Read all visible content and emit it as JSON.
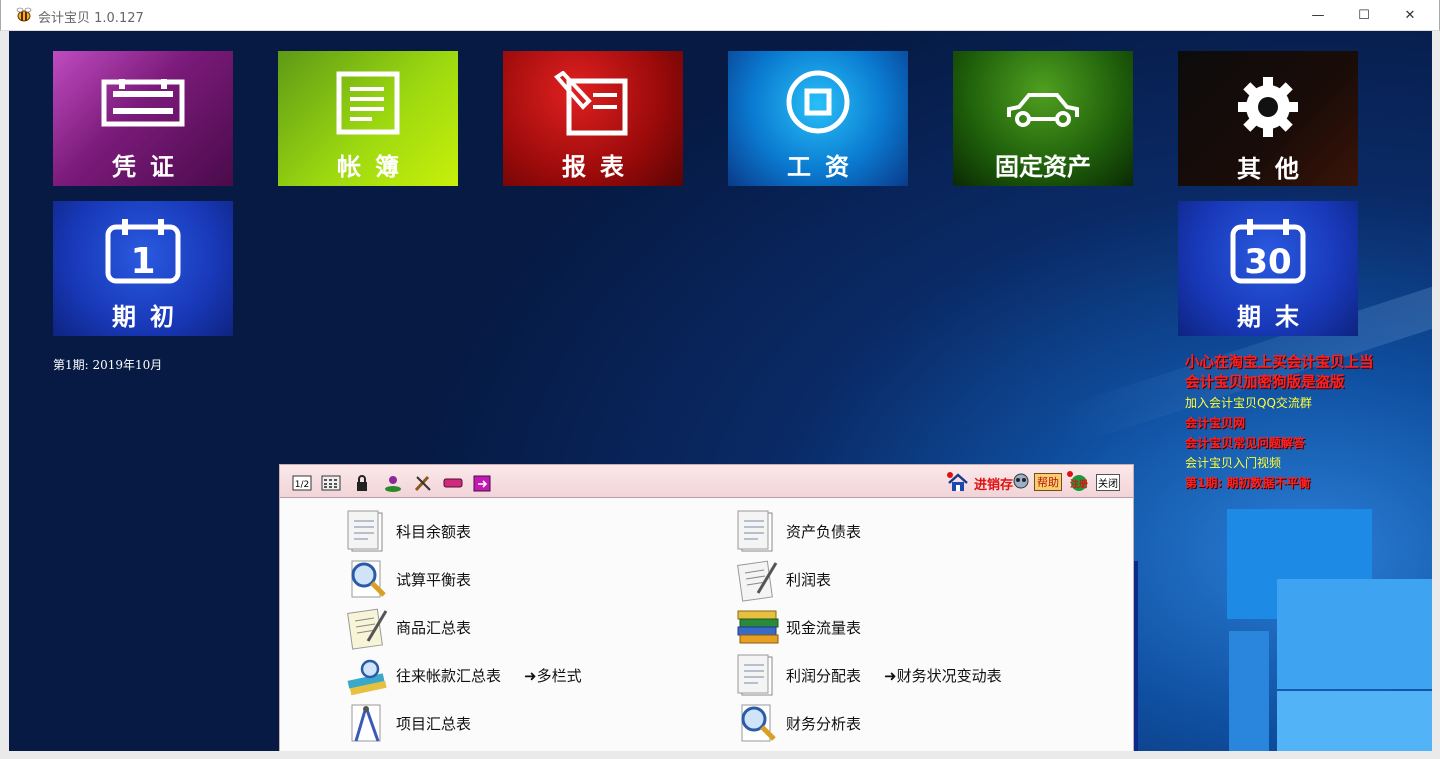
{
  "window": {
    "title": "会计宝贝 1.0.127",
    "minimize_glyph": "—",
    "maximize_glyph": "☐",
    "close_glyph": "✕"
  },
  "tiles": {
    "voucher": "凭证",
    "ledger": "帐簿",
    "report": "报表",
    "salary": "工资",
    "fixed_assets": "固定资产",
    "other": "其他",
    "opening": "期初",
    "opening_day": "1",
    "closing": "期末",
    "closing_day": "30"
  },
  "period": "第1期: 2019年10月",
  "notices": [
    "小心在淘宝上买会计宝贝上当",
    "会计宝贝加密狗版是盗版",
    "加入会计宝贝QQ交流群",
    "会计宝贝网",
    "会计宝贝常见问题解答",
    "会计宝贝入门视频",
    "第1期: 期初数据不平衡"
  ],
  "panel": {
    "toolbar": {
      "inventory": "进销存",
      "help": "帮助",
      "close": "关闭",
      "register": "注册",
      "tool_1_2": "1/2"
    },
    "left_items": [
      "科目余额表",
      "试算平衡表",
      "商品汇总表",
      "往来帐款汇总表",
      "项目汇总表"
    ],
    "right_items": [
      "资产负债表",
      "利润表",
      "现金流量表",
      "利润分配表",
      "财务分析表"
    ],
    "multi_column": "➜多栏式",
    "financial_change": "➜财务状况变动表"
  },
  "colors": {
    "notice_red": "#ff2020",
    "notice_yellow": "#ffff33",
    "desktop_blue": "#0a2a66"
  }
}
